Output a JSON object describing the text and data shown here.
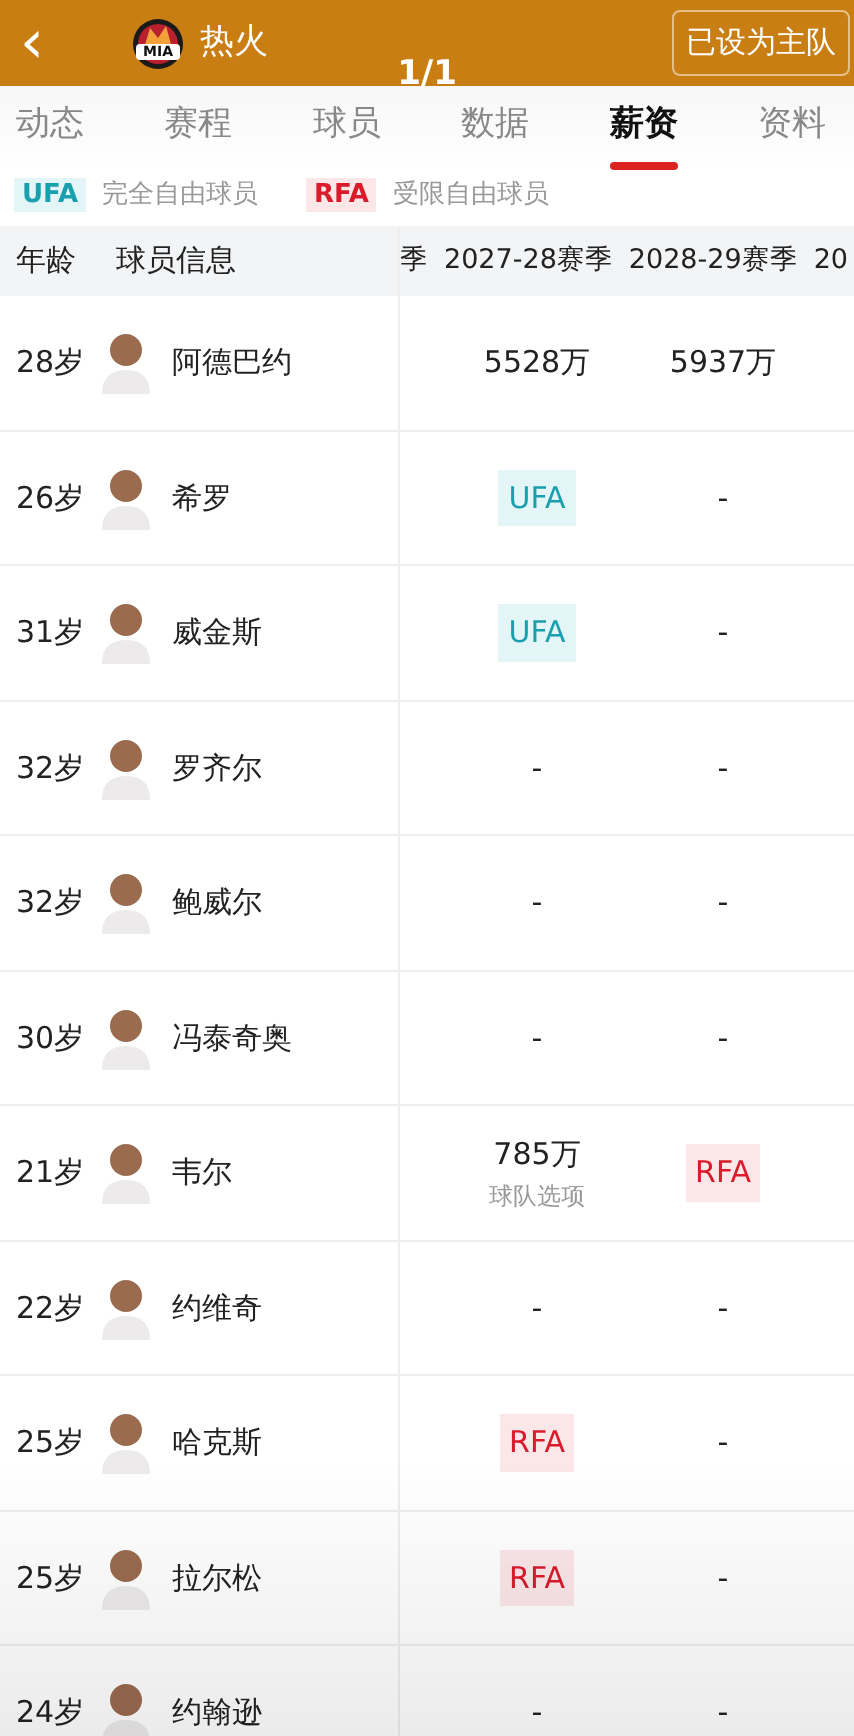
{
  "header": {
    "back": "‹",
    "team": "热火",
    "logo_text": "MIA",
    "home_button": "已设为主队",
    "page_counter": "1/1"
  },
  "tabs": [
    {
      "label": "动态",
      "selected": false
    },
    {
      "label": "赛程",
      "selected": false
    },
    {
      "label": "球员",
      "selected": false
    },
    {
      "label": "数据",
      "selected": false
    },
    {
      "label": "薪资",
      "selected": true
    },
    {
      "label": "资料",
      "selected": false
    }
  ],
  "legend": [
    {
      "tag": "UFA",
      "kind": "ufa",
      "text": "完全自由球员"
    },
    {
      "tag": "RFA",
      "kind": "rfa",
      "text": "受限自由球员"
    }
  ],
  "table": {
    "columns": [
      "年龄",
      "球员信息",
      "季",
      "2027-28赛季",
      "2028-29赛季",
      "20"
    ],
    "rows": [
      {
        "age": "28岁",
        "name": "阿德巴约",
        "cells": [
          {
            "kind": "text",
            "text": "5528万"
          },
          {
            "kind": "text",
            "text": "5937万"
          }
        ]
      },
      {
        "age": "26岁",
        "name": "希罗",
        "cells": [
          {
            "kind": "ufa",
            "text": "UFA"
          },
          {
            "kind": "text",
            "text": "-"
          }
        ]
      },
      {
        "age": "31岁",
        "name": "威金斯",
        "cells": [
          {
            "kind": "ufa",
            "text": "UFA"
          },
          {
            "kind": "text",
            "text": "-"
          }
        ]
      },
      {
        "age": "32岁",
        "name": "罗齐尔",
        "cells": [
          {
            "kind": "text",
            "text": "-"
          },
          {
            "kind": "text",
            "text": "-"
          }
        ]
      },
      {
        "age": "32岁",
        "name": "鲍威尔",
        "cells": [
          {
            "kind": "text",
            "text": "-"
          },
          {
            "kind": "text",
            "text": "-"
          }
        ]
      },
      {
        "age": "30岁",
        "name": "冯泰奇奥",
        "cells": [
          {
            "kind": "text",
            "text": "-"
          },
          {
            "kind": "text",
            "text": "-"
          }
        ]
      },
      {
        "age": "21岁",
        "name": "韦尔",
        "cells": [
          {
            "kind": "text",
            "text": "785万",
            "note": "球队选项"
          },
          {
            "kind": "rfa",
            "text": "RFA"
          }
        ]
      },
      {
        "age": "22岁",
        "name": "约维奇",
        "cells": [
          {
            "kind": "text",
            "text": "-"
          },
          {
            "kind": "text",
            "text": "-"
          }
        ]
      },
      {
        "age": "25岁",
        "name": "哈克斯",
        "cells": [
          {
            "kind": "rfa",
            "text": "RFA"
          },
          {
            "kind": "text",
            "text": "-"
          }
        ]
      },
      {
        "age": "25岁",
        "name": "拉尔松",
        "cells": [
          {
            "kind": "rfa",
            "text": "RFA"
          },
          {
            "kind": "text",
            "text": "-"
          }
        ]
      },
      {
        "age": "24岁",
        "name": "约翰逊",
        "cells": [
          {
            "kind": "text",
            "text": "-"
          },
          {
            "kind": "text",
            "text": "-"
          }
        ]
      }
    ]
  }
}
